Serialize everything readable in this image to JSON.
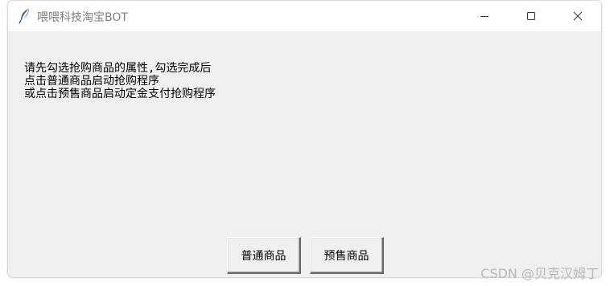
{
  "window": {
    "title": "喂喂科技淘宝BOT",
    "controls": {
      "minimize_icon": "minimize-icon",
      "maximize_icon": "maximize-icon",
      "close_icon": "close-icon"
    }
  },
  "message": {
    "lines": [
      "请先勾选抢购商品的属性,勾选完成后",
      "点击普通商品启动抢购程序",
      "或点击预售商品启动定金支付抢购程序"
    ]
  },
  "buttons": {
    "normal_label": "普通商品",
    "presale_label": "预售商品"
  },
  "watermark": "CSDN @贝克汉姆丁",
  "colors": {
    "window_bg": "#f0f0f0",
    "titlebar_bg": "#ffffff",
    "title_text": "#808080",
    "watermark": "#b8b8b8"
  }
}
